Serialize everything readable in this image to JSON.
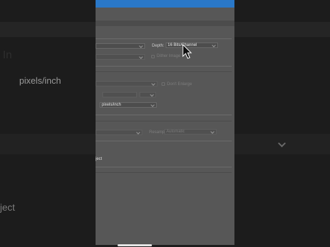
{
  "background": {
    "resolution_unit": "pixels/inch",
    "object_text": "ject"
  },
  "dialog": {
    "depth_label": "Depth:",
    "depth_value": "16 Bits/Channel",
    "dither_label": "Dither Image",
    "lock_layers_label": "Don't Enlarge",
    "res_unit_value": "pixels/inch",
    "resample_label": "Resample:",
    "resample_value": "Automatic",
    "object_text": "ject"
  },
  "colors": {
    "accent": "#2a78c8",
    "panel": "#575757",
    "background": "#1c1c1c"
  }
}
